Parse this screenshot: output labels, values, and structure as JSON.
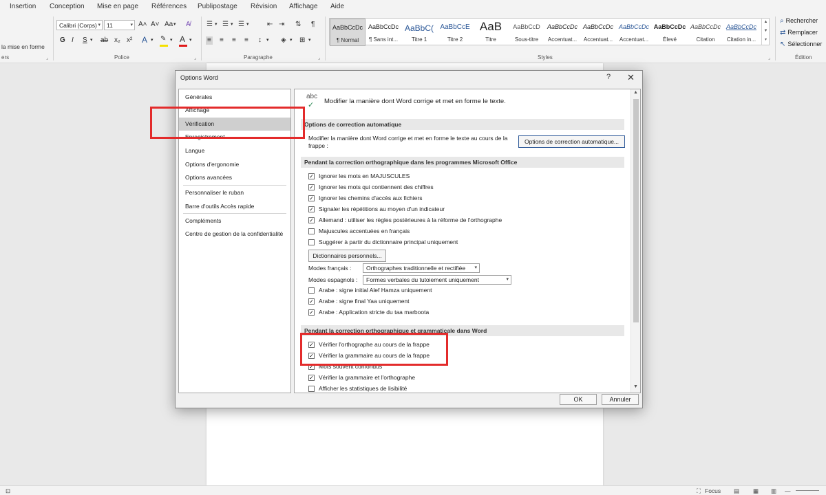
{
  "menu": [
    "Insertion",
    "Conception",
    "Mise en page",
    "Références",
    "Publipostage",
    "Révision",
    "Affichage",
    "Aide"
  ],
  "ribbon": {
    "clipboard_partial_label": "la mise en forme",
    "clipboard_group_partial": "ers",
    "font_group": "Police",
    "paragraph_group": "Paragraphe",
    "styles_group": "Styles",
    "edit_group": "Édition",
    "font_name": "Calibri (Corps)",
    "font_size": "11",
    "grow_font": "A˄",
    "shrink_font": "A˅",
    "change_case": "Aa",
    "bold": "G",
    "italic": "I",
    "underline": "S",
    "strike": "ab",
    "subscript": "x₂",
    "superscript": "x²",
    "text_effects": "A",
    "highlight": "ab",
    "font_color": "A",
    "accent_blue": "#2b5797",
    "highlight_yellow": "#f5e000",
    "font_red": "#e01919",
    "styles": [
      {
        "sample": "AaBbCcDc",
        "name": "¶ Normal",
        "active": true
      },
      {
        "sample": "AaBbCcDc",
        "name": "¶ Sans int..."
      },
      {
        "sample": "AaBbC(",
        "name": "Titre 1"
      },
      {
        "sample": "AaBbCcE",
        "name": "Titre 2"
      },
      {
        "sample": "AaB",
        "name": "Titre"
      },
      {
        "sample": "AaBbCcD",
        "name": "Sous-titre"
      },
      {
        "sample": "AaBbCcDc",
        "name": "Accentuat..."
      },
      {
        "sample": "AaBbCcDc",
        "name": "Accentuat..."
      },
      {
        "sample": "AaBbCcDc",
        "name": "Accentuat..."
      },
      {
        "sample": "AaBbCcDc",
        "name": "Élevé"
      },
      {
        "sample": "AaBbCcDc",
        "name": "Citation"
      },
      {
        "sample": "AaBbCcDc",
        "name": "Citation in..."
      }
    ],
    "find": "Rechercher",
    "replace": "Remplacer",
    "select": "Sélectionner"
  },
  "dialog": {
    "title": "Options Word",
    "help": "?",
    "close": "✕",
    "nav": [
      "Générales",
      "Affichage",
      "Vérification",
      "Enregistrement",
      "Langue",
      "Options d'ergonomie",
      "Options avancées",
      "Personnaliser le ruban",
      "Barre d'outils Accès rapide",
      "Compléments",
      "Centre de gestion de la confidentialité"
    ],
    "selected_nav": "Vérification",
    "header_icon": "abc",
    "header_text": "Modifier la manière dont Word corrige et met en forme le texte.",
    "autocorrect": {
      "title": "Options de correction automatique",
      "text_line1": "Modifier la manière dont Word corrige et met en forme le texte au cours de la",
      "text_line2": "frappe :",
      "button": "Options de correction automatique..."
    },
    "office_spelling": {
      "title": "Pendant la correction orthographique dans les programmes Microsoft Office",
      "options": [
        {
          "label": "Ignorer les mots en MAJUSCULES",
          "checked": true
        },
        {
          "label": "Ignorer les mots qui contiennent des chiffres",
          "checked": true
        },
        {
          "label": "Ignorer les chemins d'accès aux fichiers",
          "checked": true
        },
        {
          "label": "Signaler les répétitions au moyen d'un indicateur",
          "checked": true
        },
        {
          "label": "Allemand : utiliser les règles postérieures à la réforme de l'orthographe",
          "checked": true
        },
        {
          "label": "Majuscules accentuées en français",
          "checked": false
        },
        {
          "label": "Suggérer à partir du dictionnaire principal uniquement",
          "checked": false
        }
      ],
      "dict_button": "Dictionnaires personnels...",
      "french_modes_label": "Modes français :",
      "french_modes_value": "Orthographes traditionnelle et rectifiée",
      "spanish_modes_label": "Modes espagnols :",
      "spanish_modes_value": "Formes verbales du tutoiement uniquement",
      "arabic": [
        {
          "label": "Arabe : signe initial Alef Hamza uniquement",
          "checked": false
        },
        {
          "label": "Arabe : signe final Yaa uniquement",
          "checked": true
        },
        {
          "label": "Arabe : Application stricte du taa marboota",
          "checked": true
        }
      ]
    },
    "word_grammar": {
      "title": "Pendant la correction orthographique et grammaticale dans Word",
      "options": [
        {
          "label": "Vérifier l'orthographe au cours de la frappe",
          "checked": true
        },
        {
          "label": "Vérifier la grammaire au cours de la frappe",
          "checked": true
        },
        {
          "label": "Mots souvent confondus",
          "checked": true
        },
        {
          "label": "Vérifier la grammaire et l'orthographe",
          "checked": true
        },
        {
          "label": "Afficher les statistiques de lisibilité",
          "checked": false
        }
      ]
    },
    "ok": "OK",
    "cancel": "Annuler"
  },
  "statusbar": {
    "focus": "Focus"
  },
  "annotation_color": "#e32b2b"
}
